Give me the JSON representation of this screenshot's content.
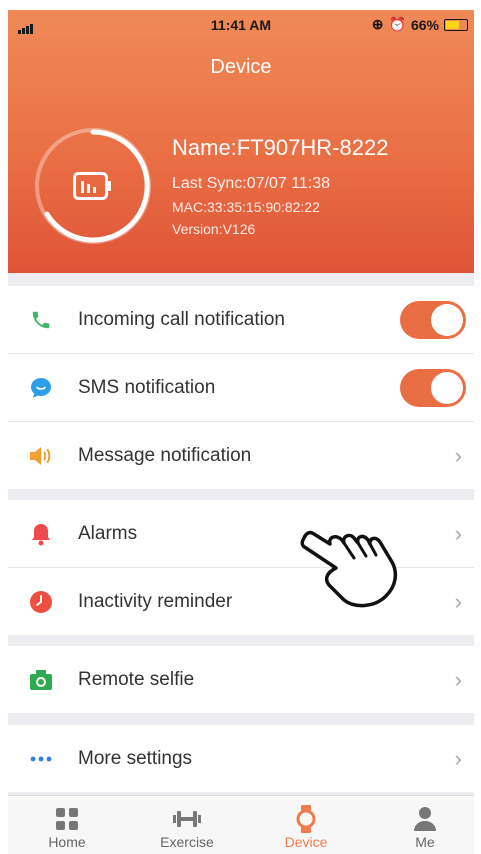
{
  "status_bar": {
    "time": "11:41 AM",
    "battery": "66%"
  },
  "header": {
    "title": "Device",
    "name": "Name:FT907HR-8222",
    "last_sync": "Last Sync:07/07 11:38",
    "mac": "MAC:33:35:15:90:82:22",
    "version": "Version:V126"
  },
  "settings": {
    "incoming_call": {
      "label": "Incoming call notification",
      "enabled": true
    },
    "sms": {
      "label": "SMS notification",
      "enabled": true
    },
    "message": {
      "label": "Message notification"
    },
    "alarms": {
      "label": "Alarms"
    },
    "inactivity": {
      "label": "Inactivity reminder"
    },
    "remote_selfie": {
      "label": "Remote selfie"
    },
    "more": {
      "label": "More settings"
    }
  },
  "tabs": [
    {
      "label": "Home"
    },
    {
      "label": "Exercise"
    },
    {
      "label": "Device"
    },
    {
      "label": "Me"
    }
  ],
  "colors": {
    "accent": "#ea6e43",
    "header_top": "#f08a57",
    "header_bottom": "#df5437"
  }
}
